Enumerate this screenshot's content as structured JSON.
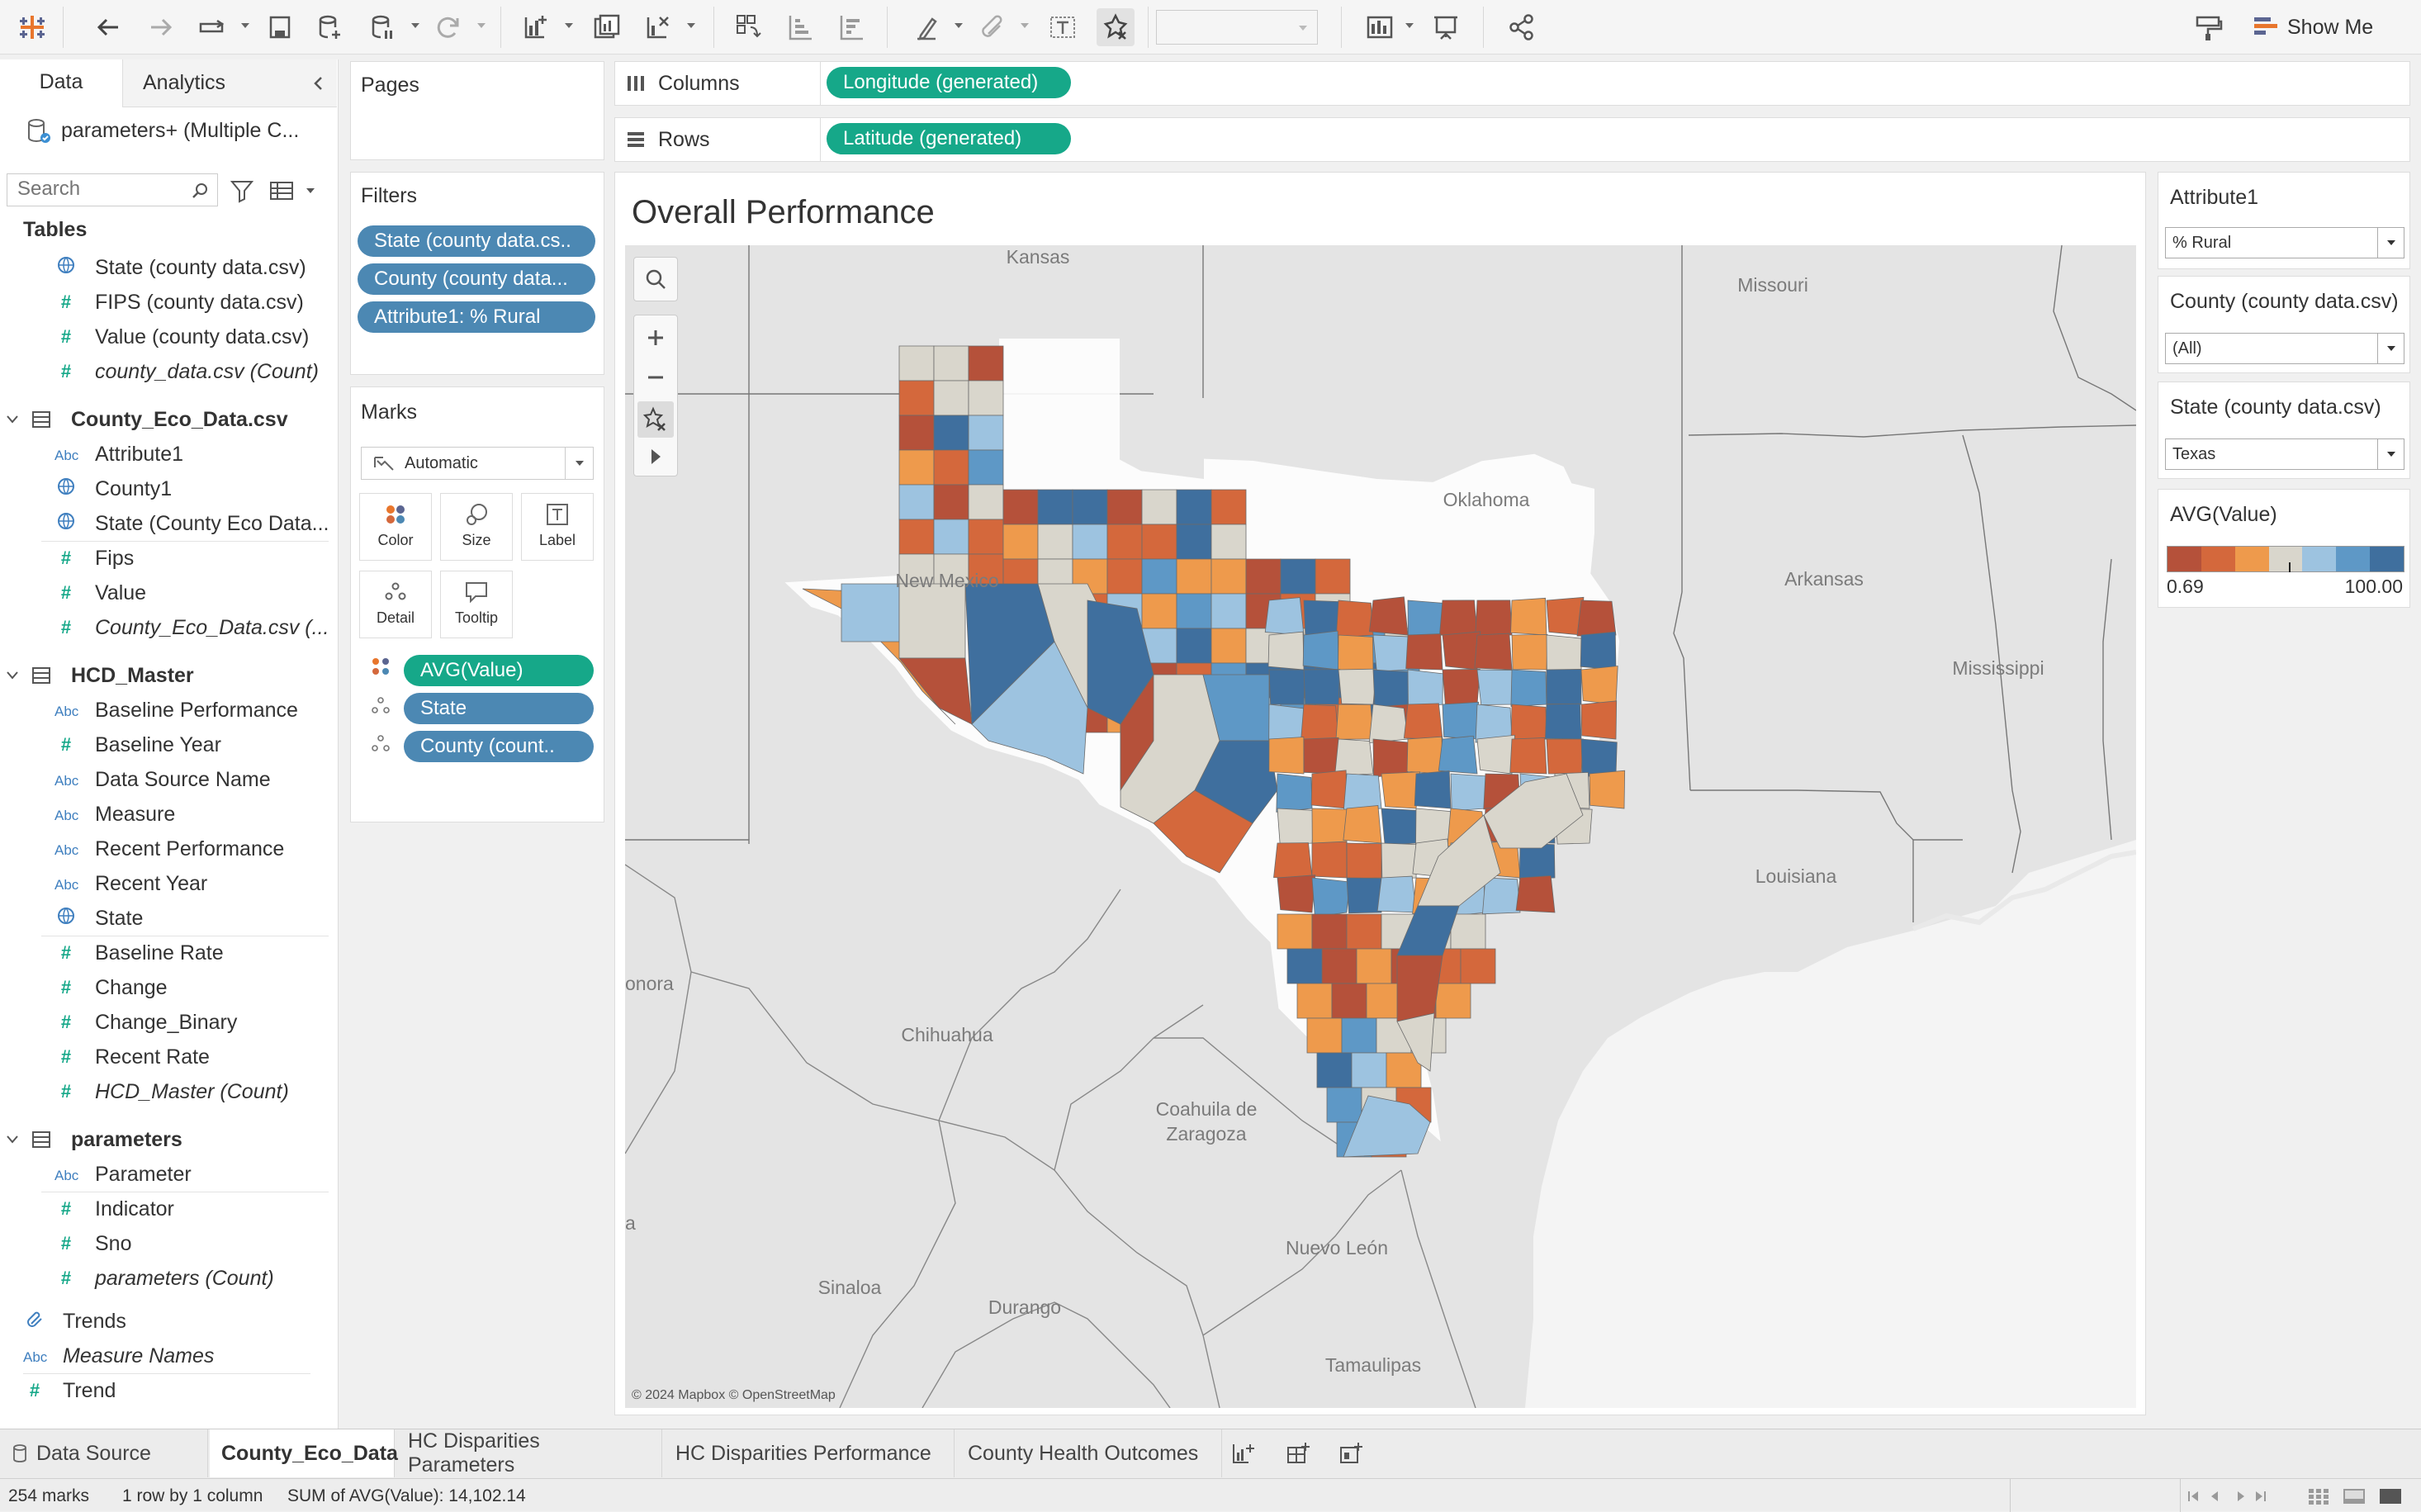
{
  "toolbar": {
    "show_me_label": "Show Me",
    "fit_value": ""
  },
  "data_pane": {
    "tabs": {
      "data": "Data",
      "analytics": "Analytics"
    },
    "datasource": "parameters+ (Multiple C...",
    "search_placeholder": "Search",
    "tables_header": "Tables",
    "top_fields": [
      {
        "icon": "globe",
        "label": "State (county data.csv)"
      },
      {
        "icon": "#",
        "label": "FIPS (county data.csv)"
      },
      {
        "icon": "#",
        "label": "Value (county data.csv)"
      },
      {
        "icon": "#",
        "label": "county_data.csv (Count)",
        "italic": true
      }
    ],
    "groups": [
      {
        "name": "County_Eco_Data.csv",
        "fields": [
          {
            "icon": "Abc",
            "label": "Attribute1"
          },
          {
            "icon": "globe",
            "label": "County1"
          },
          {
            "icon": "globe",
            "label": "State (County Eco Data..."
          },
          {
            "icon": "#",
            "label": "Fips"
          },
          {
            "icon": "#",
            "label": "Value"
          },
          {
            "icon": "#",
            "label": "County_Eco_Data.csv (...",
            "italic": true
          }
        ]
      },
      {
        "name": "HCD_Master",
        "fields": [
          {
            "icon": "Abc",
            "label": "Baseline Performance"
          },
          {
            "icon": "#",
            "label": "Baseline Year"
          },
          {
            "icon": "Abc",
            "label": "Data Source Name"
          },
          {
            "icon": "Abc",
            "label": "Measure"
          },
          {
            "icon": "Abc",
            "label": "Recent Performance"
          },
          {
            "icon": "Abc",
            "label": "Recent Year"
          },
          {
            "icon": "globe",
            "label": "State"
          },
          {
            "icon": "#",
            "label": "Baseline Rate"
          },
          {
            "icon": "#",
            "label": "Change"
          },
          {
            "icon": "#",
            "label": "Change_Binary"
          },
          {
            "icon": "#",
            "label": "Recent Rate"
          },
          {
            "icon": "#",
            "label": "HCD_Master (Count)",
            "italic": true
          }
        ]
      },
      {
        "name": "parameters",
        "fields": [
          {
            "icon": "Abc",
            "label": "Parameter"
          },
          {
            "icon": "#",
            "label": "Indicator"
          },
          {
            "icon": "#",
            "label": "Sno"
          },
          {
            "icon": "#",
            "label": "parameters (Count)",
            "italic": true
          }
        ]
      }
    ],
    "bottom_fields": [
      {
        "icon": "clip",
        "label": "Trends"
      },
      {
        "icon": "Abc",
        "label": "Measure Names",
        "italic": true
      },
      {
        "icon": "#",
        "label": "Trend"
      }
    ]
  },
  "shelves": {
    "pages": "Pages",
    "filters_title": "Filters",
    "filters": [
      "State (county data.cs..",
      "County (county data...",
      "Attribute1: % Rural"
    ],
    "marks_title": "Marks",
    "mark_type": "Automatic",
    "mark_buttons": {
      "color": "Color",
      "size": "Size",
      "label": "Label",
      "detail": "Detail",
      "tooltip": "Tooltip"
    },
    "mark_pills": [
      "AVG(Value)",
      "State",
      "County (count.."
    ],
    "columns_label": "Columns",
    "columns_pill": "Longitude (generated)",
    "rows_label": "Rows",
    "rows_pill": "Latitude (generated)"
  },
  "view": {
    "title": "Overall Performance",
    "attribution": "© 2024 Mapbox © OpenStreetMap",
    "map_labels": {
      "kansas": "Kansas",
      "missouri": "Missouri",
      "oklahoma": "Oklahoma",
      "new_mexico": "New Mexico",
      "arkansas": "Arkansas",
      "mississippi": "Mississippi",
      "louisiana": "Louisiana",
      "chihuahua": "Chihuahua",
      "coahuila1": "Coahuila de",
      "coahuila2": "Zaragoza",
      "nuevo_leon": "Nuevo León",
      "sinaloa": "Sinaloa",
      "durango": "Durango",
      "tamaulipas": "Tamaulipas",
      "sonora": "onora",
      "a": "a"
    },
    "palette": [
      "#b5513a",
      "#d4683c",
      "#ee9a4c",
      "#d9d6cc",
      "#9dc3e0",
      "#5e98c6",
      "#3f6f9e"
    ]
  },
  "right_pane": {
    "attribute1_title": "Attribute1",
    "attribute1_value": "% Rural",
    "county_title": "County (county data.csv)",
    "county_value": "(All)",
    "state_title": "State (county data.csv)",
    "state_value": "Texas",
    "legend_title": "AVG(Value)",
    "legend_min": "0.69",
    "legend_max": "100.00"
  },
  "sheet_tabs": {
    "data_source": "Data Source",
    "tabs": [
      "County_Eco_Data",
      "HC Disparities Parameters",
      "HC Disparities Performance",
      "County Health Outcomes"
    ],
    "active": "County_Eco_Data"
  },
  "status": {
    "marks": "254 marks",
    "rows_cols": "1 row by 1 column",
    "sum": "SUM of AVG(Value): 14,102.14"
  }
}
